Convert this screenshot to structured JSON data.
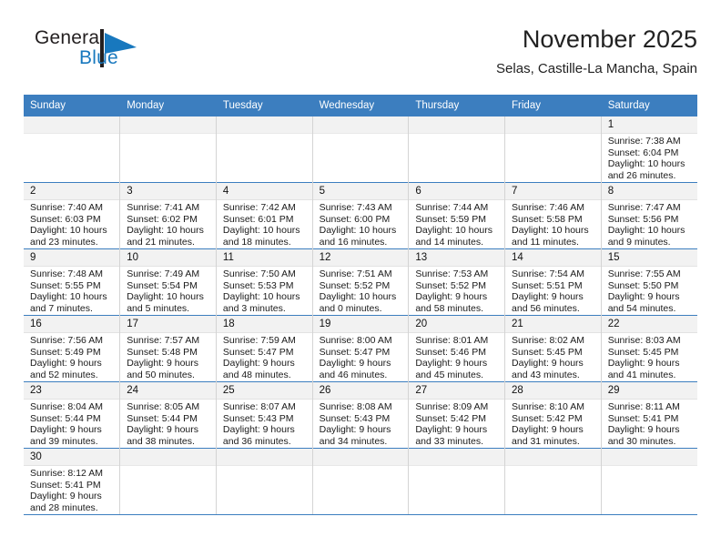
{
  "brand": {
    "name_part1": "General",
    "name_part2": "Blue",
    "mark": "triangle-flag-icon"
  },
  "header": {
    "title": "November 2025",
    "subtitle": "Selas, Castille-La Mancha, Spain"
  },
  "colors": {
    "header_blue": "#3c7ebf",
    "brand_blue": "#1878be",
    "daynum_background": "#f2f2f2",
    "text": "#1a1a1a"
  },
  "weekday_headers": [
    "Sunday",
    "Monday",
    "Tuesday",
    "Wednesday",
    "Thursday",
    "Friday",
    "Saturday"
  ],
  "labels": {
    "sunrise_prefix": "Sunrise:",
    "sunset_prefix": "Sunset:",
    "daylight_prefix": "Daylight:"
  },
  "weeks": [
    [
      {
        "day": "",
        "lines": [
          "",
          "",
          "",
          ""
        ]
      },
      {
        "day": "",
        "lines": [
          "",
          "",
          "",
          ""
        ]
      },
      {
        "day": "",
        "lines": [
          "",
          "",
          "",
          ""
        ]
      },
      {
        "day": "",
        "lines": [
          "",
          "",
          "",
          ""
        ]
      },
      {
        "day": "",
        "lines": [
          "",
          "",
          "",
          ""
        ]
      },
      {
        "day": "",
        "lines": [
          "",
          "",
          "",
          ""
        ]
      },
      {
        "day": "1",
        "lines": [
          "Sunrise: 7:38 AM",
          "Sunset: 6:04 PM",
          "Daylight: 10 hours",
          "and 26 minutes."
        ]
      }
    ],
    [
      {
        "day": "2",
        "lines": [
          "Sunrise: 7:40 AM",
          "Sunset: 6:03 PM",
          "Daylight: 10 hours",
          "and 23 minutes."
        ]
      },
      {
        "day": "3",
        "lines": [
          "Sunrise: 7:41 AM",
          "Sunset: 6:02 PM",
          "Daylight: 10 hours",
          "and 21 minutes."
        ]
      },
      {
        "day": "4",
        "lines": [
          "Sunrise: 7:42 AM",
          "Sunset: 6:01 PM",
          "Daylight: 10 hours",
          "and 18 minutes."
        ]
      },
      {
        "day": "5",
        "lines": [
          "Sunrise: 7:43 AM",
          "Sunset: 6:00 PM",
          "Daylight: 10 hours",
          "and 16 minutes."
        ]
      },
      {
        "day": "6",
        "lines": [
          "Sunrise: 7:44 AM",
          "Sunset: 5:59 PM",
          "Daylight: 10 hours",
          "and 14 minutes."
        ]
      },
      {
        "day": "7",
        "lines": [
          "Sunrise: 7:46 AM",
          "Sunset: 5:58 PM",
          "Daylight: 10 hours",
          "and 11 minutes."
        ]
      },
      {
        "day": "8",
        "lines": [
          "Sunrise: 7:47 AM",
          "Sunset: 5:56 PM",
          "Daylight: 10 hours",
          "and 9 minutes."
        ]
      }
    ],
    [
      {
        "day": "9",
        "lines": [
          "Sunrise: 7:48 AM",
          "Sunset: 5:55 PM",
          "Daylight: 10 hours",
          "and 7 minutes."
        ]
      },
      {
        "day": "10",
        "lines": [
          "Sunrise: 7:49 AM",
          "Sunset: 5:54 PM",
          "Daylight: 10 hours",
          "and 5 minutes."
        ]
      },
      {
        "day": "11",
        "lines": [
          "Sunrise: 7:50 AM",
          "Sunset: 5:53 PM",
          "Daylight: 10 hours",
          "and 3 minutes."
        ]
      },
      {
        "day": "12",
        "lines": [
          "Sunrise: 7:51 AM",
          "Sunset: 5:52 PM",
          "Daylight: 10 hours",
          "and 0 minutes."
        ]
      },
      {
        "day": "13",
        "lines": [
          "Sunrise: 7:53 AM",
          "Sunset: 5:52 PM",
          "Daylight: 9 hours",
          "and 58 minutes."
        ]
      },
      {
        "day": "14",
        "lines": [
          "Sunrise: 7:54 AM",
          "Sunset: 5:51 PM",
          "Daylight: 9 hours",
          "and 56 minutes."
        ]
      },
      {
        "day": "15",
        "lines": [
          "Sunrise: 7:55 AM",
          "Sunset: 5:50 PM",
          "Daylight: 9 hours",
          "and 54 minutes."
        ]
      }
    ],
    [
      {
        "day": "16",
        "lines": [
          "Sunrise: 7:56 AM",
          "Sunset: 5:49 PM",
          "Daylight: 9 hours",
          "and 52 minutes."
        ]
      },
      {
        "day": "17",
        "lines": [
          "Sunrise: 7:57 AM",
          "Sunset: 5:48 PM",
          "Daylight: 9 hours",
          "and 50 minutes."
        ]
      },
      {
        "day": "18",
        "lines": [
          "Sunrise: 7:59 AM",
          "Sunset: 5:47 PM",
          "Daylight: 9 hours",
          "and 48 minutes."
        ]
      },
      {
        "day": "19",
        "lines": [
          "Sunrise: 8:00 AM",
          "Sunset: 5:47 PM",
          "Daylight: 9 hours",
          "and 46 minutes."
        ]
      },
      {
        "day": "20",
        "lines": [
          "Sunrise: 8:01 AM",
          "Sunset: 5:46 PM",
          "Daylight: 9 hours",
          "and 45 minutes."
        ]
      },
      {
        "day": "21",
        "lines": [
          "Sunrise: 8:02 AM",
          "Sunset: 5:45 PM",
          "Daylight: 9 hours",
          "and 43 minutes."
        ]
      },
      {
        "day": "22",
        "lines": [
          "Sunrise: 8:03 AM",
          "Sunset: 5:45 PM",
          "Daylight: 9 hours",
          "and 41 minutes."
        ]
      }
    ],
    [
      {
        "day": "23",
        "lines": [
          "Sunrise: 8:04 AM",
          "Sunset: 5:44 PM",
          "Daylight: 9 hours",
          "and 39 minutes."
        ]
      },
      {
        "day": "24",
        "lines": [
          "Sunrise: 8:05 AM",
          "Sunset: 5:44 PM",
          "Daylight: 9 hours",
          "and 38 minutes."
        ]
      },
      {
        "day": "25",
        "lines": [
          "Sunrise: 8:07 AM",
          "Sunset: 5:43 PM",
          "Daylight: 9 hours",
          "and 36 minutes."
        ]
      },
      {
        "day": "26",
        "lines": [
          "Sunrise: 8:08 AM",
          "Sunset: 5:43 PM",
          "Daylight: 9 hours",
          "and 34 minutes."
        ]
      },
      {
        "day": "27",
        "lines": [
          "Sunrise: 8:09 AM",
          "Sunset: 5:42 PM",
          "Daylight: 9 hours",
          "and 33 minutes."
        ]
      },
      {
        "day": "28",
        "lines": [
          "Sunrise: 8:10 AM",
          "Sunset: 5:42 PM",
          "Daylight: 9 hours",
          "and 31 minutes."
        ]
      },
      {
        "day": "29",
        "lines": [
          "Sunrise: 8:11 AM",
          "Sunset: 5:41 PM",
          "Daylight: 9 hours",
          "and 30 minutes."
        ]
      }
    ],
    [
      {
        "day": "30",
        "lines": [
          "Sunrise: 8:12 AM",
          "Sunset: 5:41 PM",
          "Daylight: 9 hours",
          "and 28 minutes."
        ]
      },
      {
        "day": "",
        "lines": [
          "",
          "",
          "",
          ""
        ]
      },
      {
        "day": "",
        "lines": [
          "",
          "",
          "",
          ""
        ]
      },
      {
        "day": "",
        "lines": [
          "",
          "",
          "",
          ""
        ]
      },
      {
        "day": "",
        "lines": [
          "",
          "",
          "",
          ""
        ]
      },
      {
        "day": "",
        "lines": [
          "",
          "",
          "",
          ""
        ]
      },
      {
        "day": "",
        "lines": [
          "",
          "",
          "",
          ""
        ]
      }
    ]
  ]
}
